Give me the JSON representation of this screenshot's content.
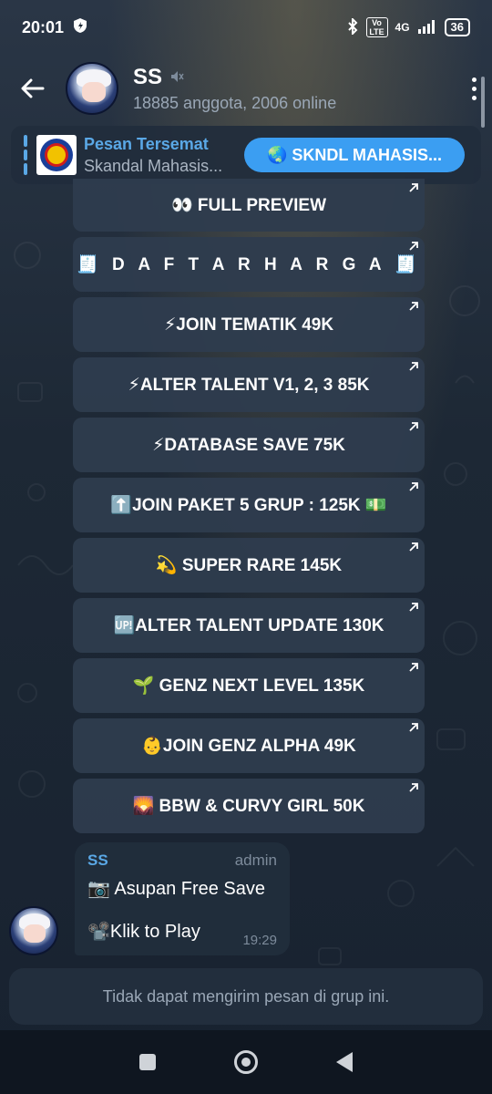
{
  "status_bar": {
    "time": "20:01",
    "network": "4G",
    "volte": "Vo LTE",
    "battery": "36"
  },
  "header": {
    "title": "SS",
    "subtitle": "18885 anggota, 2006 online"
  },
  "pinned": {
    "title": "Pesan Tersemat",
    "body": "Skandal Mahasis...",
    "action": "🌏 SKNDL MAHASIS..."
  },
  "keyboard_buttons": [
    {
      "label": "👀 FULL PREVIEW"
    },
    {
      "label": "🧾 D A F T A R  H A R G A 🧾"
    },
    {
      "label": "⚡JOIN TEMATIK  49K"
    },
    {
      "label": "⚡ALTER TALENT V1, 2, 3  85K"
    },
    {
      "label": "⚡DATABASE SAVE  75K"
    },
    {
      "label": "⬆️JOIN PAKET 5 GRUP   : 125K 💵"
    },
    {
      "label": "💫 SUPER RARE  145K"
    },
    {
      "label": "🆙ALTER TALENT UPDATE 130K"
    },
    {
      "label": "🌱 GENZ NEXT LEVEL 135K"
    },
    {
      "label": "👶JOIN GENZ ALPHA  49K"
    },
    {
      "label": "🌄 BBW & CURVY GIRL  50K"
    }
  ],
  "message": {
    "sender": "SS",
    "role": "admin",
    "line1": "📷 Asupan Free Save",
    "line2": "📽️Klik to Play",
    "time": "19:29"
  },
  "input": {
    "placeholder": "Tidak dapat mengirim pesan di grup ini."
  },
  "colors": {
    "accent": "#5aa8e6",
    "action_button": "#3b9ef2",
    "button_bg": "#2e3c4e"
  }
}
